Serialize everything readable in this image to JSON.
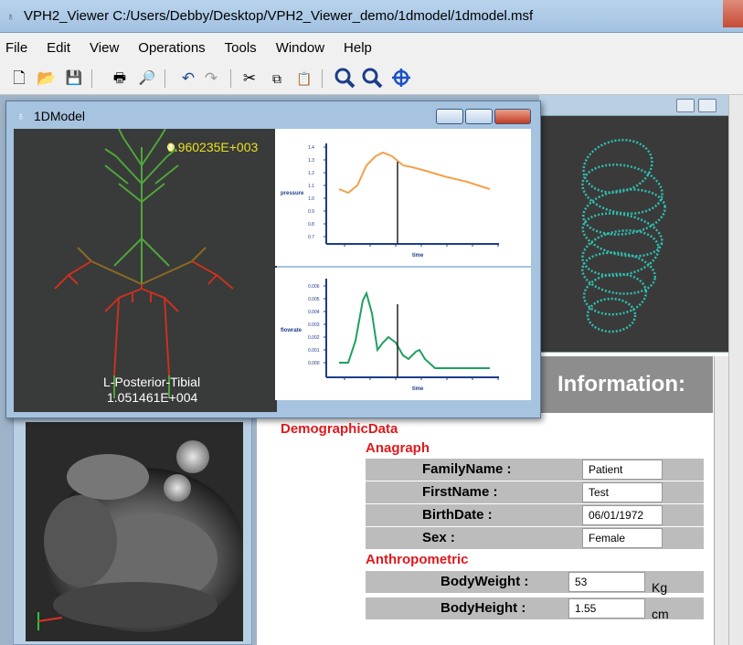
{
  "app": {
    "title": "VPH2_Viewer  C:/Users/Debby/Desktop/VPH2_Viewer_demo/1dmodel/1dmodel.msf"
  },
  "menu": [
    "File",
    "Edit",
    "View",
    "Operations",
    "Tools",
    "Window",
    "Help"
  ],
  "toolbar": {
    "icons": [
      "new-icon",
      "open-icon",
      "save-icon",
      "print-icon",
      "print-preview-icon",
      "undo-icon",
      "redo-icon",
      "cut-icon",
      "copy-icon",
      "paste-icon",
      "zoom-all-icon",
      "zoom-selection-icon",
      "center-icon"
    ]
  },
  "model_window": {
    "title": "1DModel",
    "top_value": "9.960235E+003",
    "vessel_name": "L-Posterior-Tibial",
    "vessel_value": "1.051461E+004",
    "chart_top": {
      "ylabel": "pressure",
      "xlabel": "time"
    },
    "chart_bottom": {
      "ylabel": "flowrate",
      "xlabel": "time"
    }
  },
  "info": {
    "header": "Information:",
    "demographic_label": "DemographicData",
    "anagraph_label": "Anagraph",
    "anagraph": [
      {
        "label": "FamilyName :",
        "value": "Patient"
      },
      {
        "label": "FirstName :",
        "value": "Test"
      },
      {
        "label": "BirthDate :",
        "value": "06/01/1972"
      },
      {
        "label": "Sex :",
        "value": "Female"
      }
    ],
    "anthropometric_label": "Anthropometric",
    "anthropometric": [
      {
        "label": "BodyWeight :",
        "value": "53",
        "unit": "Kg"
      },
      {
        "label": "BodyHeight :",
        "value": "1.55",
        "unit": "cm"
      }
    ]
  },
  "colors": {
    "pressure_curve": "#f4a04a",
    "flow_curve": "#20a060",
    "vessel_green": "#4fa63a",
    "vessel_red": "#c8321e",
    "rings": "#2fc0b0",
    "label_red": "#e0191d"
  }
}
